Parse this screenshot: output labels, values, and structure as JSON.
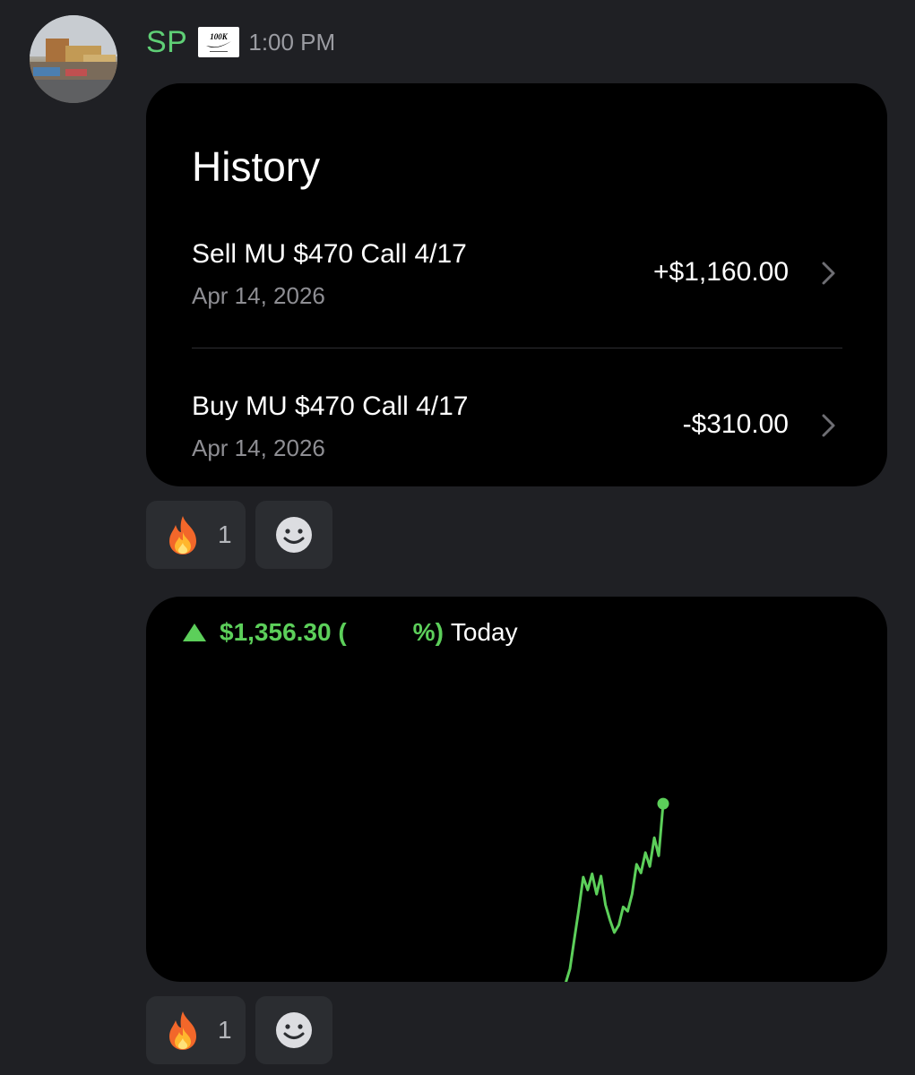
{
  "message": {
    "username": "SP",
    "role_badge_icon": "100k-nike-badge-icon",
    "timestamp": "1:00 PM"
  },
  "history_card": {
    "title": "History",
    "rows": [
      {
        "description": "Sell MU $470 Call 4/17",
        "date": "Apr 14, 2026",
        "amount": "+$1,160.00"
      },
      {
        "description": "Buy MU $470 Call 4/17",
        "date": "Apr 14, 2026",
        "amount": "-$310.00"
      }
    ]
  },
  "reactions": [
    {
      "emoji_icon": "fire-emoji-icon",
      "count": "1"
    },
    {
      "emoji_icon": "fire-emoji-icon",
      "count": "1"
    }
  ],
  "chart_card": {
    "change": "$1,356.30 (",
    "pct_suffix": "%)",
    "period": "Today",
    "accent_color": "#5ccf5a"
  },
  "chart_data": {
    "type": "line",
    "title": "",
    "xlabel": "",
    "ylabel": "",
    "grid": false,
    "series": [
      {
        "values": [
          0,
          14,
          42,
          70,
          100,
          88,
          103,
          84,
          101,
          74,
          60,
          48,
          55,
          72,
          68,
          84,
          112,
          104,
          123,
          110,
          137,
          120,
          169
        ]
      }
    ],
    "ylim": [
      0,
      180
    ]
  }
}
